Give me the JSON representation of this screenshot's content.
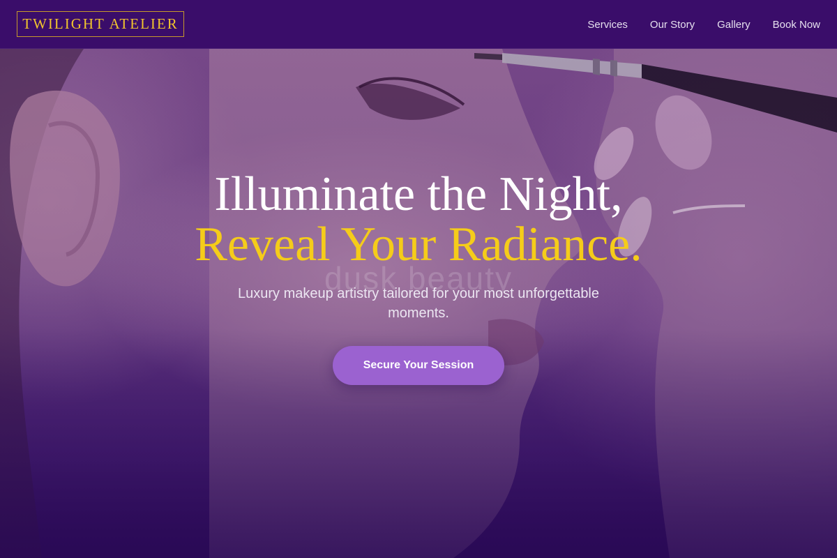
{
  "brand": {
    "logo_text": "TWILIGHT ATELIER",
    "accent_gold": "#f5cc1a",
    "primary_purple": "#3a0d6a",
    "button_purple": "#9b62d0"
  },
  "nav": {
    "items": [
      {
        "label": "Services"
      },
      {
        "label": "Our Story"
      },
      {
        "label": "Gallery"
      },
      {
        "label": "Book Now"
      }
    ]
  },
  "hero": {
    "headline_line1": "Illuminate the Night,",
    "headline_line2": "Reveal Your Radiance.",
    "watermark": "dusk beauty",
    "subtitle": "Luxury makeup artistry tailored for your most unforgettable moments.",
    "cta_label": "Secure Your Session",
    "background_image": "woman-profile-makeup-brush-photo"
  }
}
